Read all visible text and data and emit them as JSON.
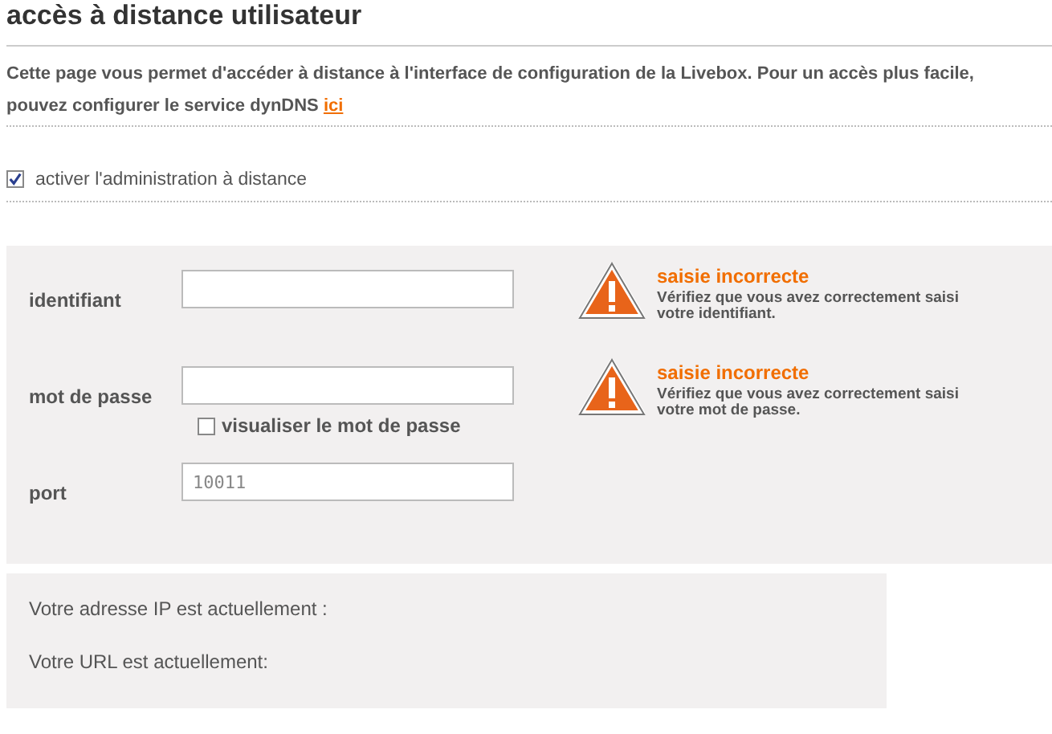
{
  "title": "accès à distance utilisateur",
  "intro": [
    "Cette page vous permet d'accéder à distance à l'interface de configuration de la Livebox. Pour un accès plus facile,",
    "pouvez configurer le service dynDNS"
  ],
  "intro_link": "ici",
  "remote_admin": {
    "label": "activer l'administration à distance",
    "checked": true
  },
  "fields": [
    {
      "label": "identifiant",
      "error": {
        "title": "saisie incorrecte",
        "message": "Vérifiez que vous avez correctement saisi votre identifiant."
      }
    },
    {
      "label": "mot de passe",
      "error": {
        "title": "saisie incorrecte",
        "message": "Vérifiez que vous avez correctement saisi votre mot de passe."
      },
      "option": {
        "label": "visualiser le mot de passe",
        "checked": false
      }
    },
    {
      "label": "port",
      "placeholder": "10011"
    }
  ],
  "status": [
    "Votre adresse IP est actuellement :",
    "Votre URL est actuellement:"
  ]
}
